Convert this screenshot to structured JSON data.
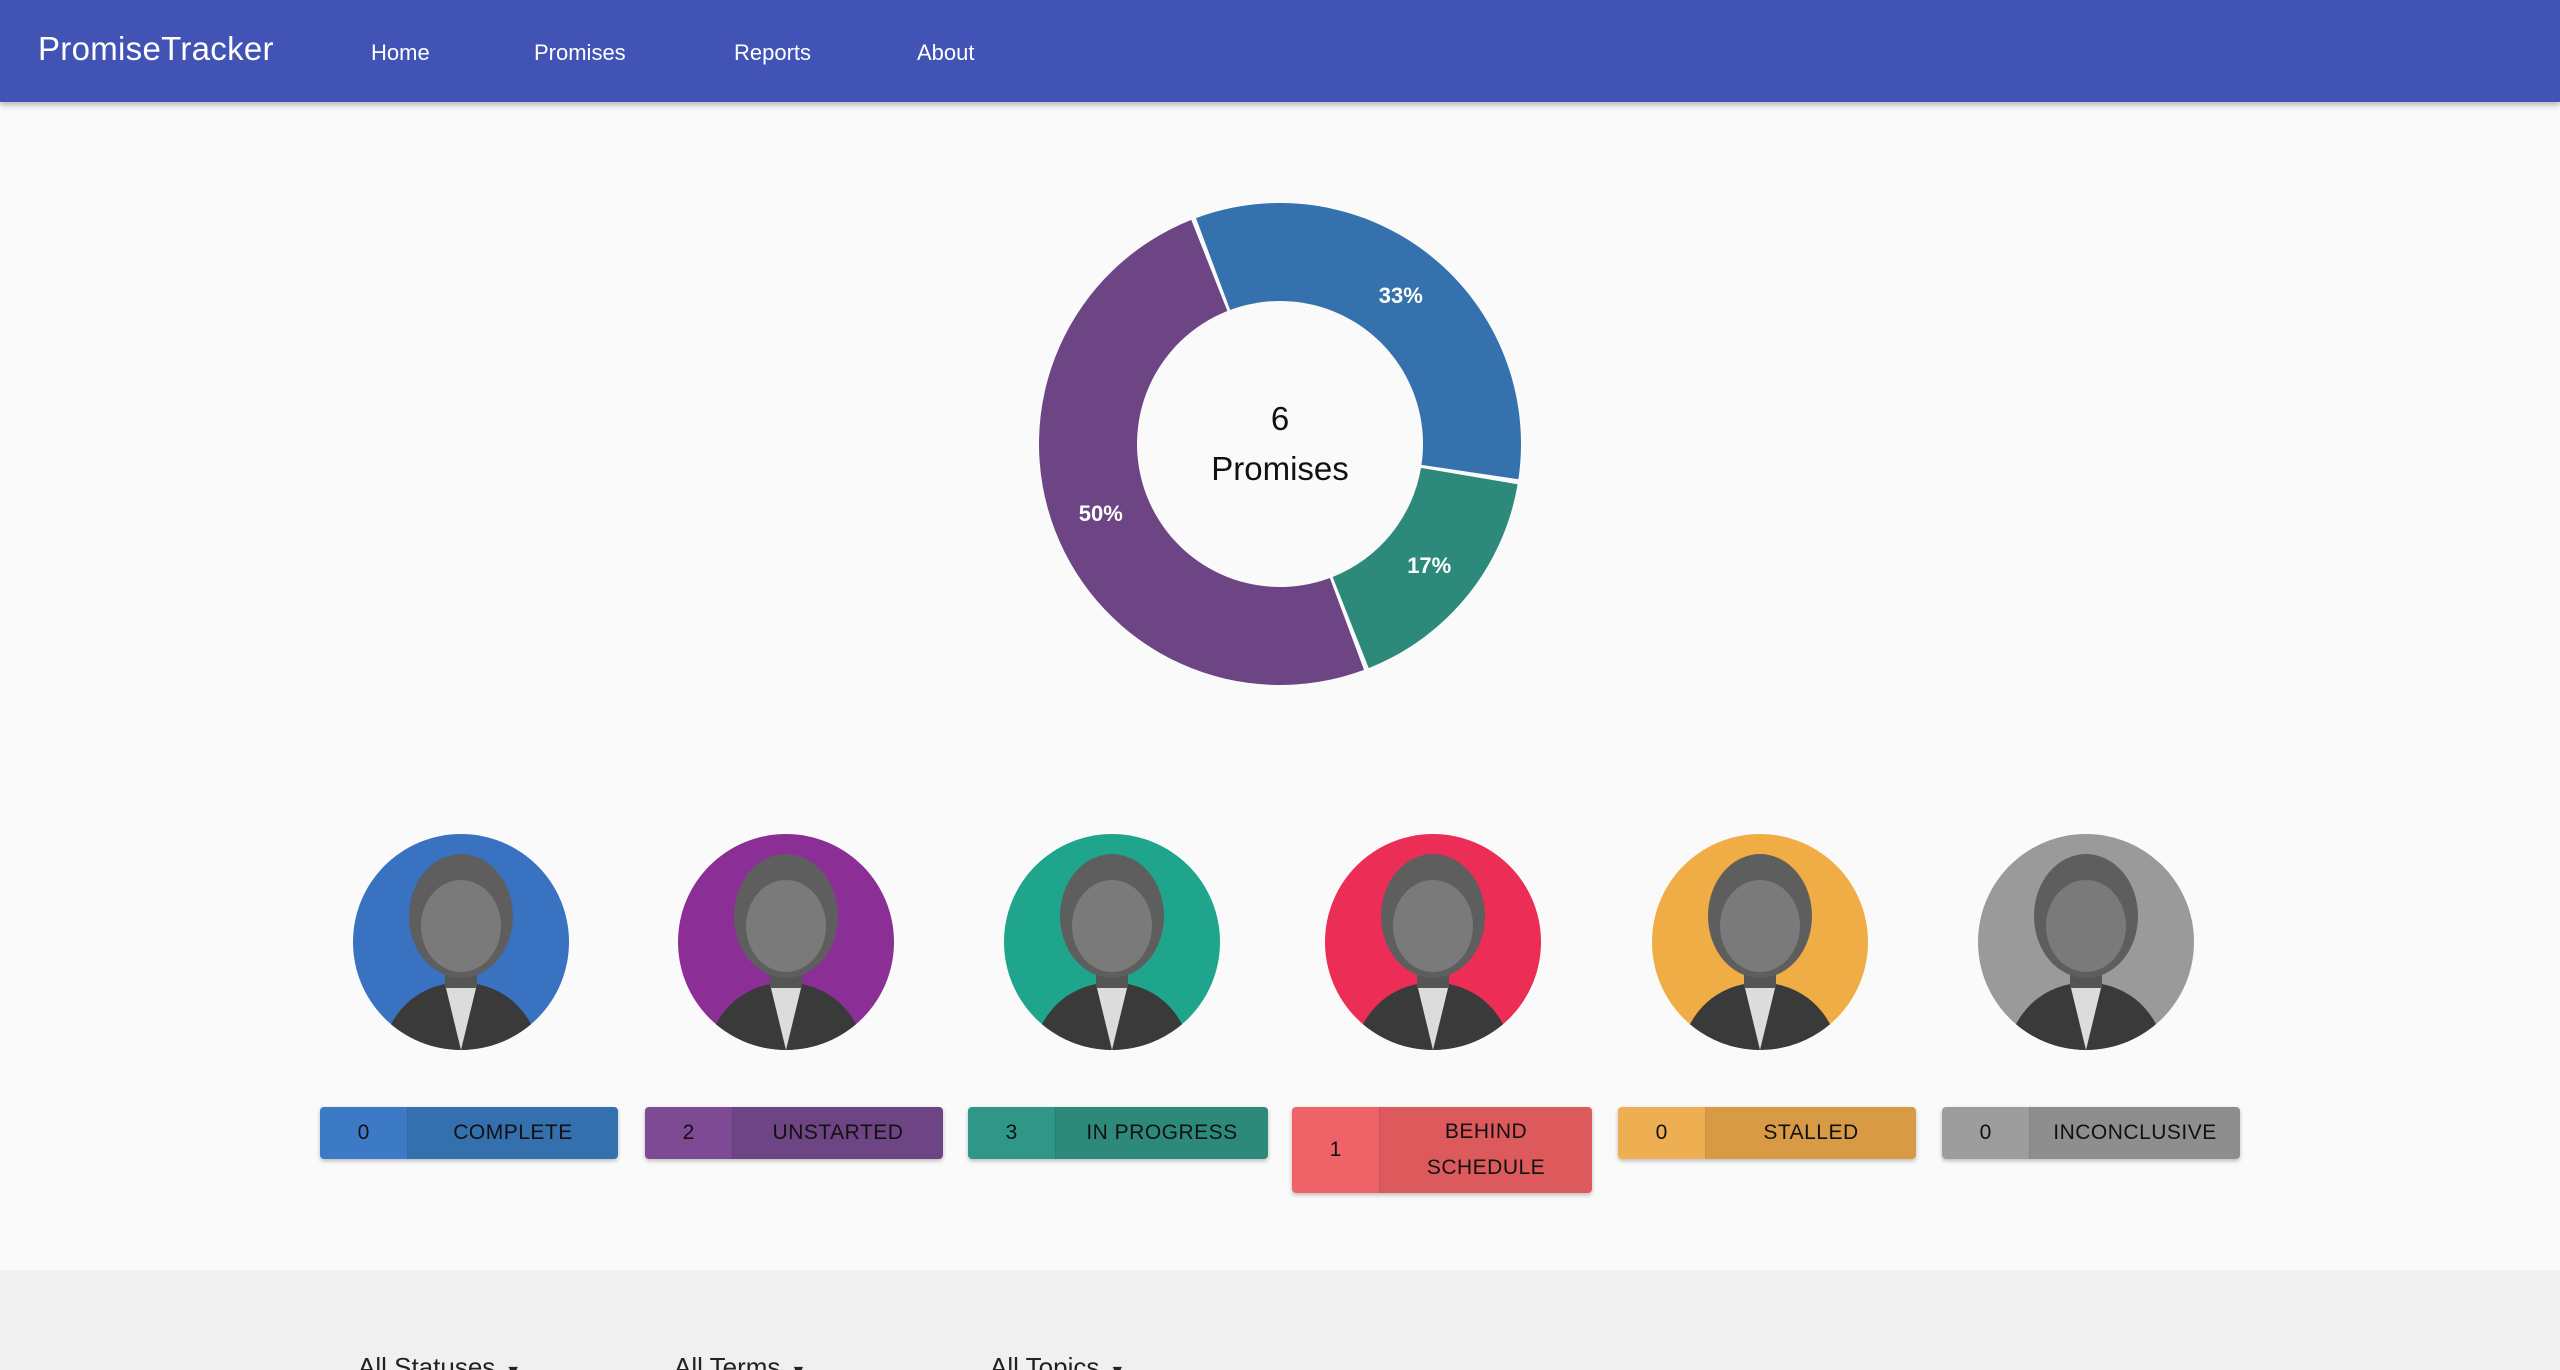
{
  "app": {
    "brand": "PromiseTracker",
    "nav": [
      "Home",
      "Promises",
      "Reports",
      "About"
    ]
  },
  "summary": {
    "total": "6",
    "total_label": "Promises"
  },
  "chart_data": {
    "type": "pie",
    "title": "",
    "slices": [
      {
        "label": "COMPLETE",
        "value": 0,
        "percent_label": "",
        "color": "#3572ad"
      },
      {
        "label": "IN PROGRESS",
        "value": 1,
        "percent_label": "17%",
        "color": "#2d8a7b"
      },
      {
        "label": "UNSTARTED",
        "value": 3,
        "percent_label": "50%",
        "color": "#6d4584"
      },
      {
        "label": "STALLED",
        "value": 0,
        "percent_label": "",
        "color": "#d99a45"
      },
      {
        "label": "IN PROGRESS",
        "value": 2,
        "percent_label": "33%",
        "color": "#3572ad"
      }
    ]
  },
  "statuses": [
    {
      "count": "0",
      "label": "COMPLETE",
      "bg": "#3a72c2",
      "chip_count": "#3d7ac6",
      "chip_label": "#346fae",
      "tall": false
    },
    {
      "count": "2",
      "label": "UNSTARTED",
      "bg": "#8b2f96",
      "chip_count": "#7d4a93",
      "chip_label": "#6d4584",
      "tall": false
    },
    {
      "count": "3",
      "label": "IN PROGRESS",
      "bg": "#1ea58c",
      "chip_count": "#2f9688",
      "chip_label": "#2d8a7b",
      "tall": false
    },
    {
      "count": "1",
      "label": "BEHIND SCHEDULE",
      "bg": "#ec2d55",
      "chip_count": "#ef6368",
      "chip_label": "#dd5a5c",
      "tall": true
    },
    {
      "count": "0",
      "label": "STALLED",
      "bg": "#f0ad45",
      "chip_count": "#eeae52",
      "chip_label": "#d99a45",
      "tall": false
    },
    {
      "count": "0",
      "label": "INCONCLUSIVE",
      "bg": "#9a9a9a",
      "chip_count": "#9d9d9d",
      "chip_label": "#8e8e8e",
      "tall": false
    }
  ],
  "filters": [
    {
      "label": "All Statuses"
    },
    {
      "label": "All Terms"
    },
    {
      "label": "All Topics"
    }
  ]
}
